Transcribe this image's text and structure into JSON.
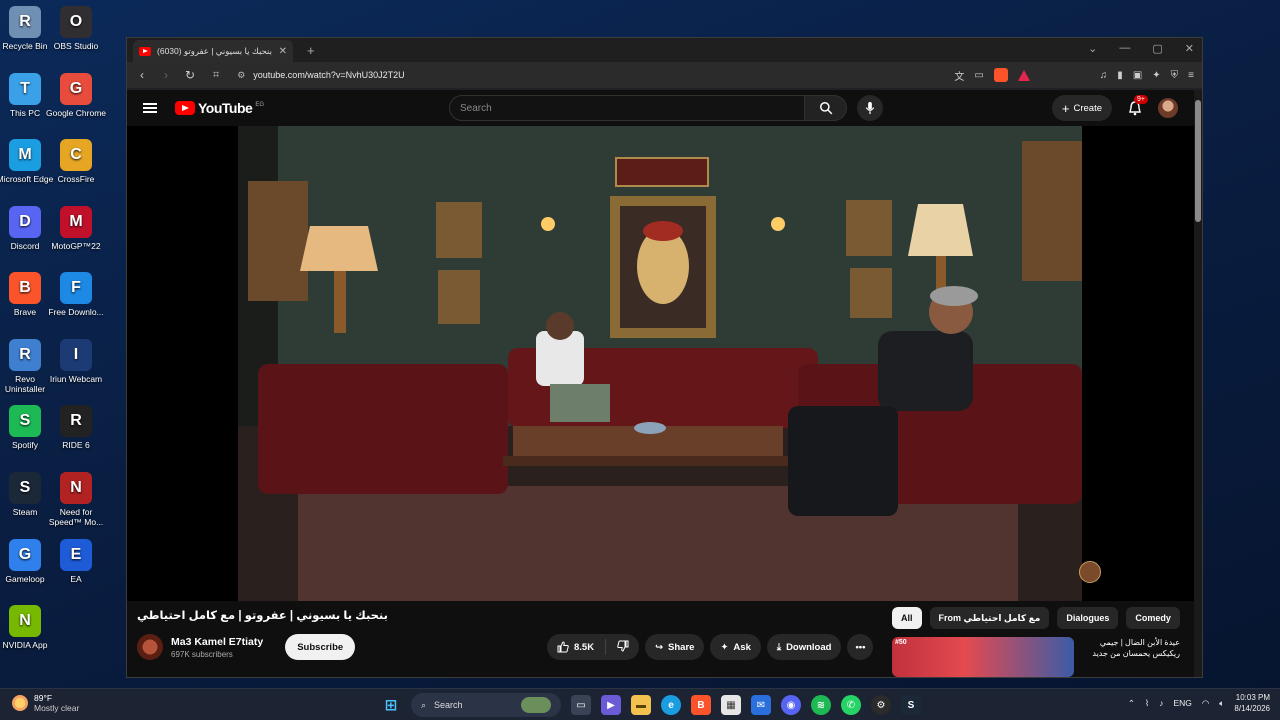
{
  "desktop": {
    "icons": [
      {
        "label": "Recycle Bin",
        "icon": "recycle-bin-icon",
        "color": "#6f8fb3"
      },
      {
        "label": "OBS Studio",
        "icon": "obs-icon",
        "color": "#302e31"
      },
      {
        "label": "This PC",
        "icon": "monitor-icon",
        "color": "#3aa0e8"
      },
      {
        "label": "Google Chrome",
        "icon": "chrome-icon",
        "color": "#e74c3c"
      },
      {
        "label": "Microsoft Edge",
        "icon": "edge-icon",
        "color": "#1b9de2"
      },
      {
        "label": "CrossFire",
        "icon": "crossfire-icon",
        "color": "#e6a623"
      },
      {
        "label": "Discord",
        "icon": "discord-icon",
        "color": "#5865f2"
      },
      {
        "label": "MotoGP™22",
        "icon": "motogp-icon",
        "color": "#c0102a"
      },
      {
        "label": "Brave",
        "icon": "brave-icon",
        "color": "#fb542b"
      },
      {
        "label": "Free Downlo...",
        "icon": "download-icon",
        "color": "#1e88e5"
      },
      {
        "label": "Revo Uninstaller",
        "icon": "revo-icon",
        "color": "#3f7fd0"
      },
      {
        "label": "Iriun Webcam",
        "icon": "webcam-icon",
        "color": "#1c3b74"
      },
      {
        "label": "Spotify",
        "icon": "spotify-icon",
        "color": "#1db954"
      },
      {
        "label": "RIDE 6",
        "icon": "ride6-icon",
        "color": "#222222"
      },
      {
        "label": "Steam",
        "icon": "steam-icon",
        "color": "#1b2838"
      },
      {
        "label": "Need for Speed™ Mo...",
        "icon": "nfs-icon",
        "color": "#b22222"
      },
      {
        "label": "Gameloop",
        "icon": "gameloop-icon",
        "color": "#2f80ed"
      },
      {
        "label": "EA",
        "icon": "ea-icon",
        "color": "#1e5bd6"
      },
      {
        "label": "NVIDIA App",
        "icon": "nvidia-icon",
        "color": "#76b900"
      }
    ]
  },
  "browser": {
    "tab_title": "بنحبك يا بسيوني | عفروتو (6030)",
    "url": "youtube.com/watch?v=NvhU30J2T2U"
  },
  "youtube": {
    "logo_text": "YouTube",
    "logo_region": "EG",
    "search_placeholder": "Search",
    "create_label": "Create",
    "notif_count": "9+",
    "video_title": "بنحبك يا بسيوني | عفروتو | مع كامل احتياطي",
    "channel_name": "Ma3 Kamel E7tiaty",
    "subscribers": "697K subscribers",
    "subscribe_label": "Subscribe",
    "likes": "8.5K",
    "share_label": "Share",
    "ask_label": "Ask",
    "download_label": "Download",
    "chips": [
      "All",
      "From مع كامل احتياطي",
      "Dialogues",
      "Comedy"
    ],
    "rec_badge": "#50",
    "rec_title": "عيدة الأبن الضال | جيمي ريكيكس يحمسان من جديد"
  },
  "taskbar": {
    "temp": "89°F",
    "weather": "Mostly clear",
    "search_label": "Search",
    "lang": "ENG",
    "time": "10:03 PM",
    "date": "8/14/2026"
  }
}
